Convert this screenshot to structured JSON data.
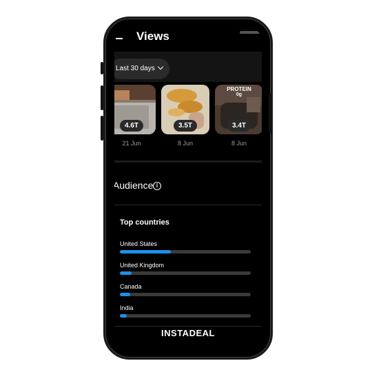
{
  "header": {
    "title": "Views"
  },
  "filter": {
    "label": "Last 30 days"
  },
  "thumbnails": [
    {
      "count": "4.6T",
      "date": "21 Jun"
    },
    {
      "count": "3.5T",
      "date": "8 Jun"
    },
    {
      "count": "3.4T",
      "date": "8 Jun",
      "overlay_text": "PROTEIN",
      "overlay_sub": "0g"
    }
  ],
  "audience": {
    "title": "Audience"
  },
  "top_countries": {
    "title": "Top countries",
    "items": [
      {
        "name": "United States",
        "share": 0.39
      },
      {
        "name": "United Kingdom",
        "share": 0.09
      },
      {
        "name": "Canada",
        "share": 0.08
      },
      {
        "name": "India",
        "share": 0.05
      }
    ]
  },
  "watermark": "INSTADEAL",
  "colors": {
    "accent": "#1d8fe8",
    "background": "#000000",
    "track": "#3a3a3a"
  }
}
